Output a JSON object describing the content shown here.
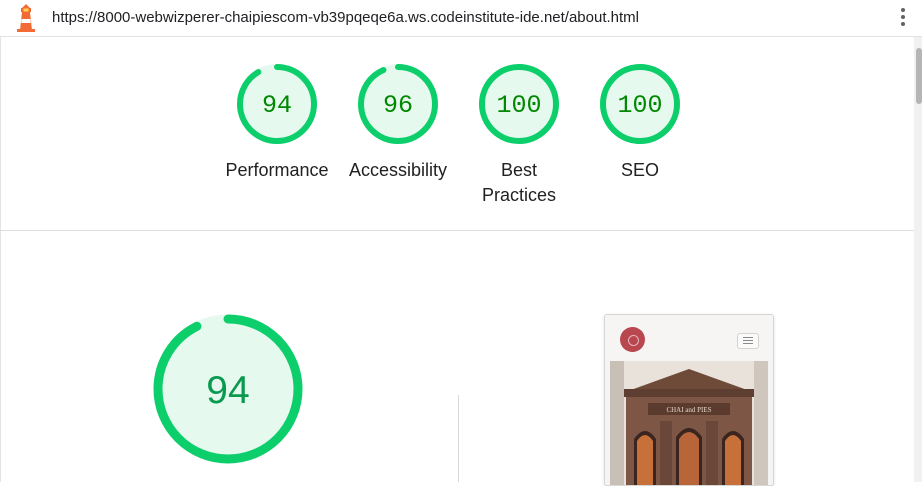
{
  "browser": {
    "url": "https://8000-webwizperer-chaipiescom-vb39pqeqe6a.ws.codeinstitute-ide.net/about.html",
    "logo_icon": "lighthouse-icon",
    "menu_icon": "more-vert-icon"
  },
  "scores": [
    {
      "label": "Performance",
      "value": 94
    },
    {
      "label": "Accessibility",
      "value": 96
    },
    {
      "label": "Best Practices",
      "value": 100
    },
    {
      "label": "SEO",
      "value": 100
    }
  ],
  "main_gauge": {
    "value": 94
  },
  "thumbnail": {
    "sign_text": "CHAI and PIES"
  },
  "colors": {
    "pass": "#0cce6b",
    "pass_text": "#008800",
    "pass_fill": "#e6f9ee",
    "track": "#e6f9ee",
    "brand": "#b8474f"
  }
}
